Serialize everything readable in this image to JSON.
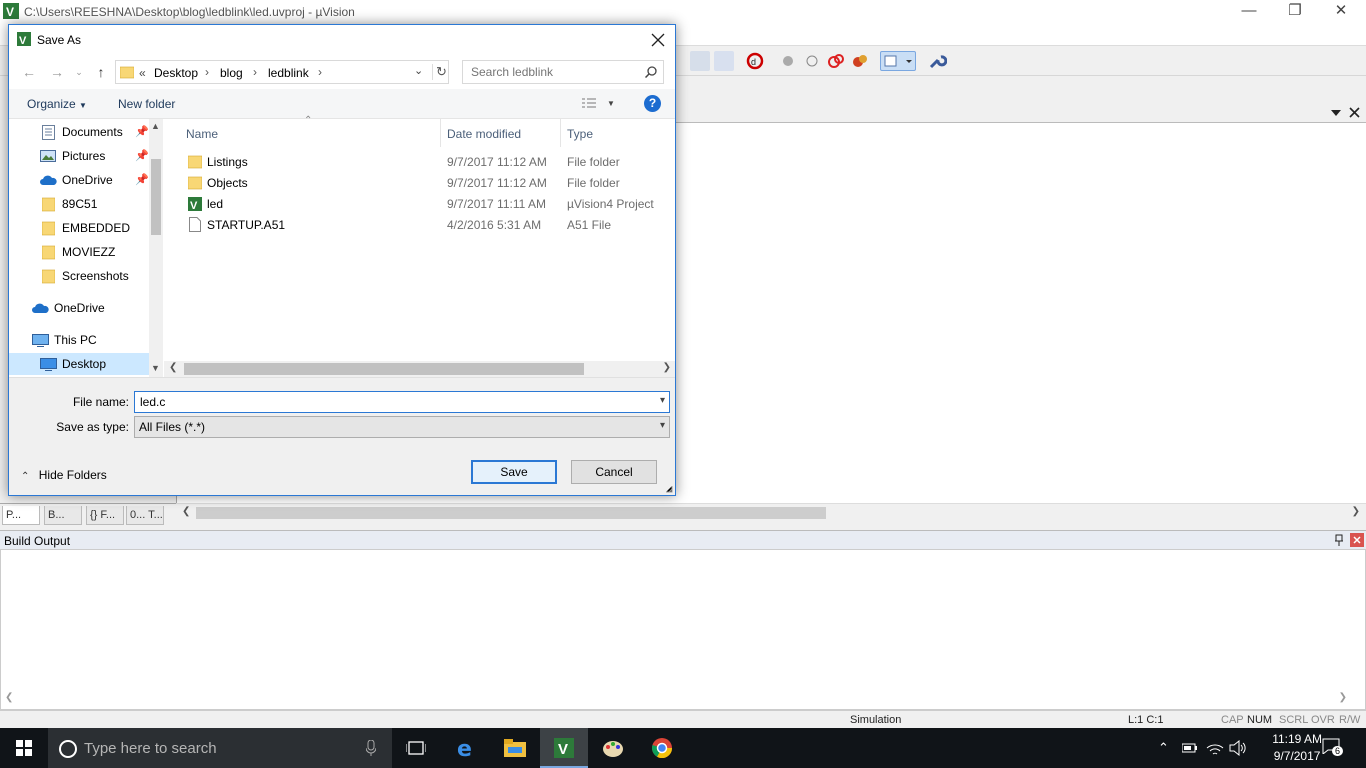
{
  "app": {
    "title": "C:\\Users\\REESHNA\\Desktop\\blog\\ledblink\\led.uvproj - µVision",
    "minimize": "—",
    "restore": "❐",
    "close": "✕"
  },
  "project_tabs": [
    "P...",
    "B...",
    "{} F...",
    "0... T..."
  ],
  "build_output": {
    "title": "Build Output"
  },
  "statusbar": {
    "mode": "Simulation",
    "position": "L:1 C:1",
    "indicators": [
      "CAP",
      "NUM",
      "SCRL",
      "OVR",
      "R/W"
    ]
  },
  "taskbar": {
    "search_placeholder": "Type here to search",
    "time": "11:19 AM",
    "date": "9/7/2017",
    "notification_count": "6"
  },
  "dialog": {
    "title": "Save As",
    "breadcrumb": [
      "«",
      "Desktop",
      "blog",
      "ledblink"
    ],
    "search_placeholder": "Search ledblink",
    "organize": "Organize",
    "new_folder": "New folder",
    "help": "?",
    "nav_items": [
      {
        "label": "Documents",
        "icon": "documents-icon",
        "pinned": true
      },
      {
        "label": "Pictures",
        "icon": "pictures-icon",
        "pinned": true
      },
      {
        "label": "OneDrive",
        "icon": "onedrive-icon",
        "pinned": true
      },
      {
        "label": "89C51",
        "icon": "folder-icon",
        "pinned": false
      },
      {
        "label": "EMBEDDED",
        "icon": "folder-icon",
        "pinned": false
      },
      {
        "label": "MOVIEZZ",
        "icon": "folder-icon",
        "pinned": false
      },
      {
        "label": "Screenshots",
        "icon": "folder-icon",
        "pinned": false
      },
      {
        "label": "OneDrive",
        "icon": "onedrive-icon",
        "pinned": false
      },
      {
        "label": "This PC",
        "icon": "pc-icon",
        "pinned": false
      },
      {
        "label": "Desktop",
        "icon": "desktop-icon",
        "pinned": false
      }
    ],
    "columns": {
      "name": "Name",
      "date": "Date modified",
      "type": "Type"
    },
    "files": [
      {
        "name": "Listings",
        "date": "9/7/2017 11:12 AM",
        "type": "File folder",
        "icon": "folder-icon"
      },
      {
        "name": "Objects",
        "date": "9/7/2017 11:12 AM",
        "type": "File folder",
        "icon": "folder-icon"
      },
      {
        "name": "led",
        "date": "9/7/2017 11:11 AM",
        "type": "µVision4 Project",
        "icon": "uvision-project-icon"
      },
      {
        "name": "STARTUP.A51",
        "date": "4/2/2016 5:31 AM",
        "type": "A51 File",
        "icon": "file-icon"
      }
    ],
    "file_name_label": "File name:",
    "file_name_value": "led.c",
    "save_type_label": "Save as type:",
    "save_type_value": "All Files (*.*)",
    "hide_folders": "Hide Folders",
    "save_button": "Save",
    "cancel_button": "Cancel"
  },
  "colors": {
    "accent": "#2b78d4",
    "selection": "#cce8ff",
    "folder": "#f8d775",
    "taskbar": "#101418"
  }
}
